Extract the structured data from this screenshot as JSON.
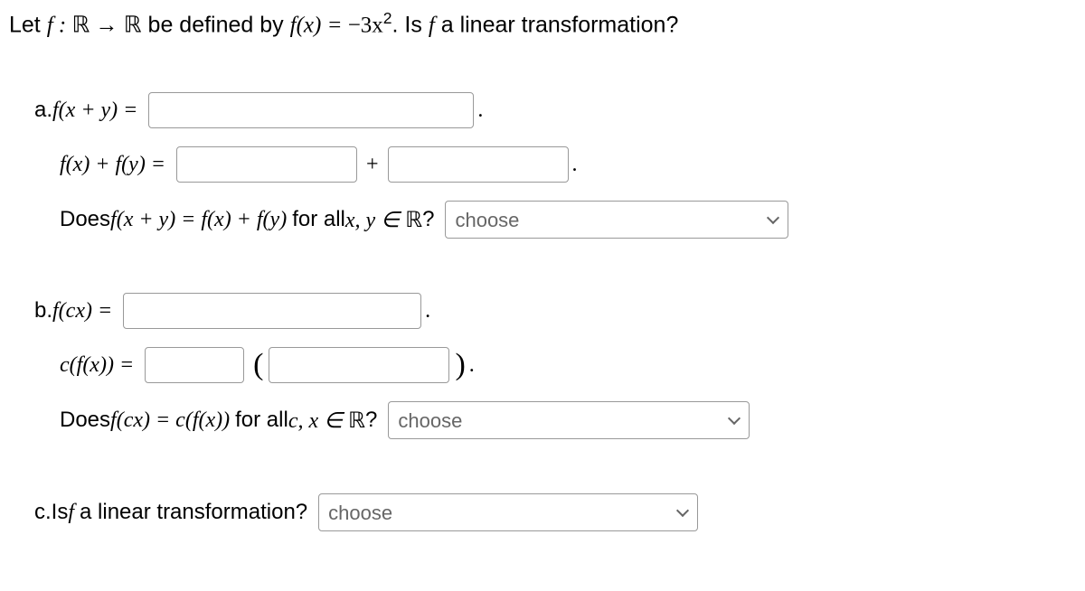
{
  "intro": {
    "prefix": "Let ",
    "f_colon": "f : ",
    "arrow": " → ",
    "defined_by": " be defined by ",
    "fx_eq": "f(x) = ",
    "neg3": "−3x",
    "sq": "2",
    "is_f": ". Is ",
    "f": "f",
    "linear_q": " a linear transformation?"
  },
  "part_a": {
    "label": "a. ",
    "fxy_eq": "f(x + y) = ",
    "fx_plus_fy_eq": "f(x) + f(y) = ",
    "plus": " + ",
    "does": "Does ",
    "fxy": "f(x + y) = f(x) + f(y)",
    "forall": " for all ",
    "xy_in": "x, y ∈ ",
    "R_q": "? "
  },
  "part_b": {
    "label": "b. ",
    "fcx_eq": "f(cx) = ",
    "cfx_eq": "c(f(x)) = ",
    "does": "Does ",
    "fcx": "f(cx) = c(f(x))",
    "forall": " for all ",
    "cx_in": "c, x ∈ ",
    "R_q": "? "
  },
  "part_c": {
    "label": "c. ",
    "text": "Is ",
    "f": "f",
    "rest": " a linear transformation? "
  },
  "dropdown": {
    "placeholder": "choose"
  }
}
